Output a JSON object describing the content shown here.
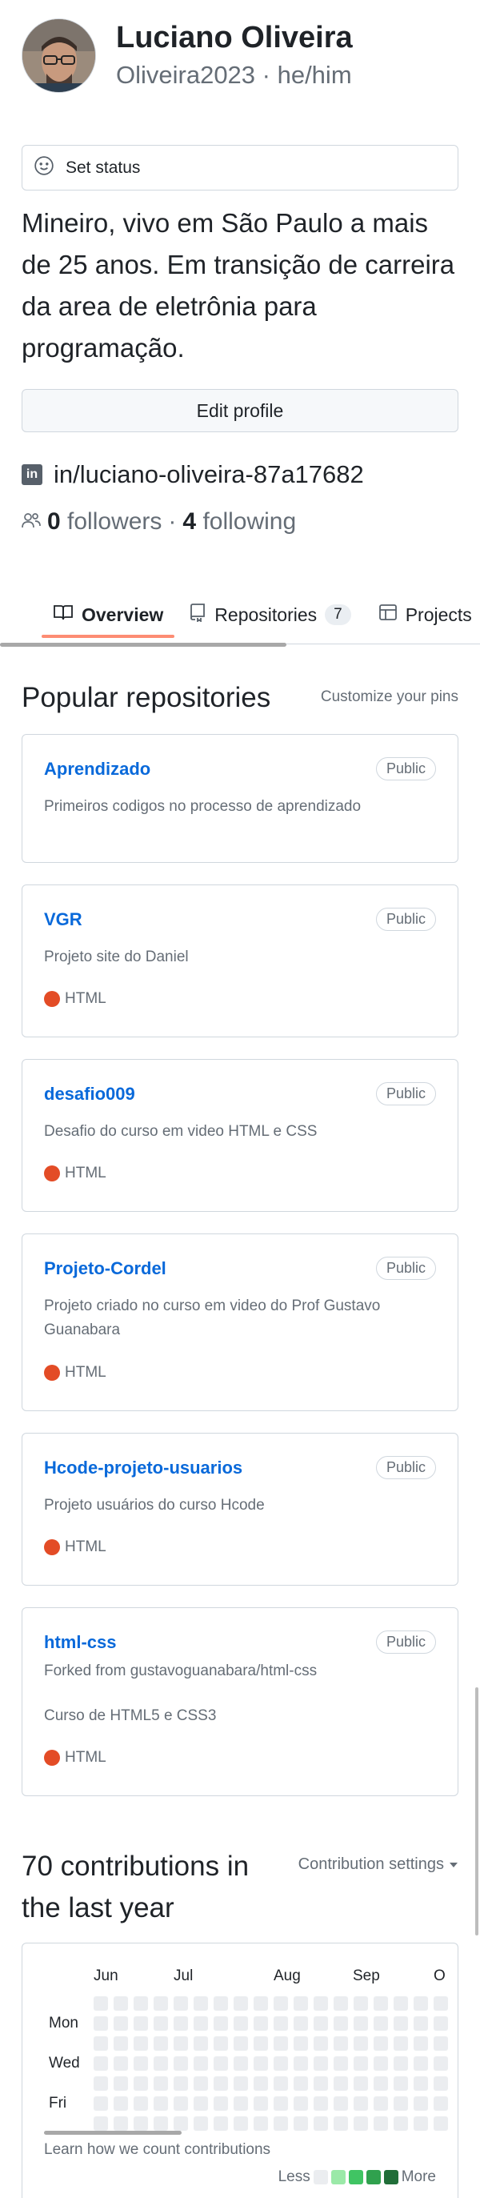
{
  "profile": {
    "name": "Luciano Oliveira",
    "login_line": "Oliveira2023 · he/him",
    "status_placeholder": "Set status",
    "bio": "Mineiro, vivo em São Paulo a mais de 25 anos. Em transição de carreira da area de eletrônia para programação.",
    "edit_label": "Edit profile",
    "linkedin": "in/luciano-oliveira-87a17682",
    "followers_count": "0",
    "followers_label": "followers",
    "separator": "·",
    "following_count": "4",
    "following_label": "following"
  },
  "tabs": [
    {
      "label": "Overview",
      "icon": "book-icon",
      "selected": true
    },
    {
      "label": "Repositories",
      "icon": "repo-icon",
      "count": "7"
    },
    {
      "label": "Projects",
      "icon": "table-icon"
    }
  ],
  "popular": {
    "title": "Popular repositories",
    "customize": "Customize your pins",
    "badge": "Public",
    "repos": [
      {
        "name": "Aprendizado",
        "desc": "Primeiros codigos no processo de aprendizado",
        "lang": ""
      },
      {
        "name": "VGR",
        "desc": "Projeto site do Daniel",
        "lang": "HTML"
      },
      {
        "name": "desafio009",
        "desc": "Desafio do curso em video HTML e CSS",
        "lang": "HTML"
      },
      {
        "name": "Projeto-Cordel",
        "desc": "Projeto criado no curso em video do Prof Gustavo Guanabara",
        "lang": "HTML"
      },
      {
        "name": "Hcode-projeto-usuarios",
        "desc": "Projeto usuários do curso Hcode",
        "lang": "HTML"
      },
      {
        "name": "html-css",
        "forked": "Forked from gustavoguanabara/html-css",
        "desc": "Curso de HTML5 e CSS3",
        "lang": "HTML"
      }
    ],
    "lang_color": "#e34c26"
  },
  "contributions": {
    "title": "70 contributions in the last year",
    "settings": "Contribution settings",
    "months": [
      "Jun",
      "Jul",
      "Aug",
      "Sep",
      "O"
    ],
    "days": [
      "Mon",
      "Wed",
      "Fri"
    ],
    "learn": "Learn how we count contributions",
    "less": "Less",
    "more": "More",
    "levels": [
      "#ebedf0",
      "#9be9a8",
      "#40c463",
      "#30a14e",
      "#216e39"
    ]
  }
}
